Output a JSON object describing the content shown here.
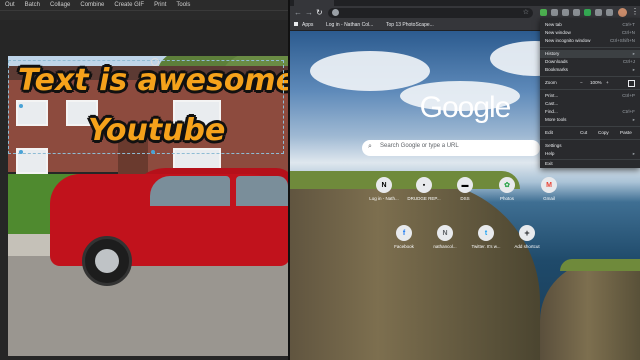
{
  "editor": {
    "menu": [
      "Out",
      "Batch",
      "Collage",
      "Combine",
      "Create GIF",
      "Print",
      "Tools"
    ],
    "text_line1": "Text is awesome",
    "text_line2": "Youtube"
  },
  "browser": {
    "bookmarks": [
      "Apps",
      "Log in - Nathan Col...",
      "Top 13 PhotoScape..."
    ],
    "logo": "Google",
    "search_placeholder": "Search Google or type a URL",
    "shortcuts_row1": [
      {
        "icon": "N",
        "label": "Log in - Nath..."
      },
      {
        "icon": "▪",
        "label": "DRUDGE REP..."
      },
      {
        "icon": "▬",
        "label": "DSS"
      },
      {
        "icon": "✿",
        "label": "Photos"
      },
      {
        "icon": "M",
        "label": "Gmail"
      }
    ],
    "shortcuts_row2": [
      {
        "icon": "f",
        "label": "Facebook"
      },
      {
        "icon": "N",
        "label": "nathancol..."
      },
      {
        "icon": "t",
        "label": "Twitter. It's w..."
      },
      {
        "icon": "+",
        "label": "Add shortcut"
      }
    ],
    "menu": {
      "new_tab": {
        "label": "New tab",
        "shortcut": "Ctrl+T"
      },
      "new_window": {
        "label": "New window",
        "shortcut": "Ctrl+N"
      },
      "new_incognito": {
        "label": "New incognito window",
        "shortcut": "Ctrl+Shift+N"
      },
      "history": {
        "label": "History",
        "shortcut": "▸"
      },
      "downloads": {
        "label": "Downloads",
        "shortcut": "Ctrl+J"
      },
      "bookmarks": {
        "label": "Bookmarks",
        "shortcut": "▸"
      },
      "zoom": {
        "label": "Zoom",
        "minus": "−",
        "value": "100%",
        "plus": "+"
      },
      "print": {
        "label": "Print...",
        "shortcut": "Ctrl+P"
      },
      "cast": {
        "label": "Cast..."
      },
      "find": {
        "label": "Find...",
        "shortcut": "Ctrl+F"
      },
      "more_tools": {
        "label": "More tools",
        "shortcut": "▸"
      },
      "edit": {
        "label": "Edit",
        "cut": "Cut",
        "copy": "Copy",
        "paste": "Paste"
      },
      "settings": {
        "label": "Settings"
      },
      "help": {
        "label": "Help",
        "shortcut": "▸"
      },
      "exit": {
        "label": "Exit"
      }
    }
  }
}
